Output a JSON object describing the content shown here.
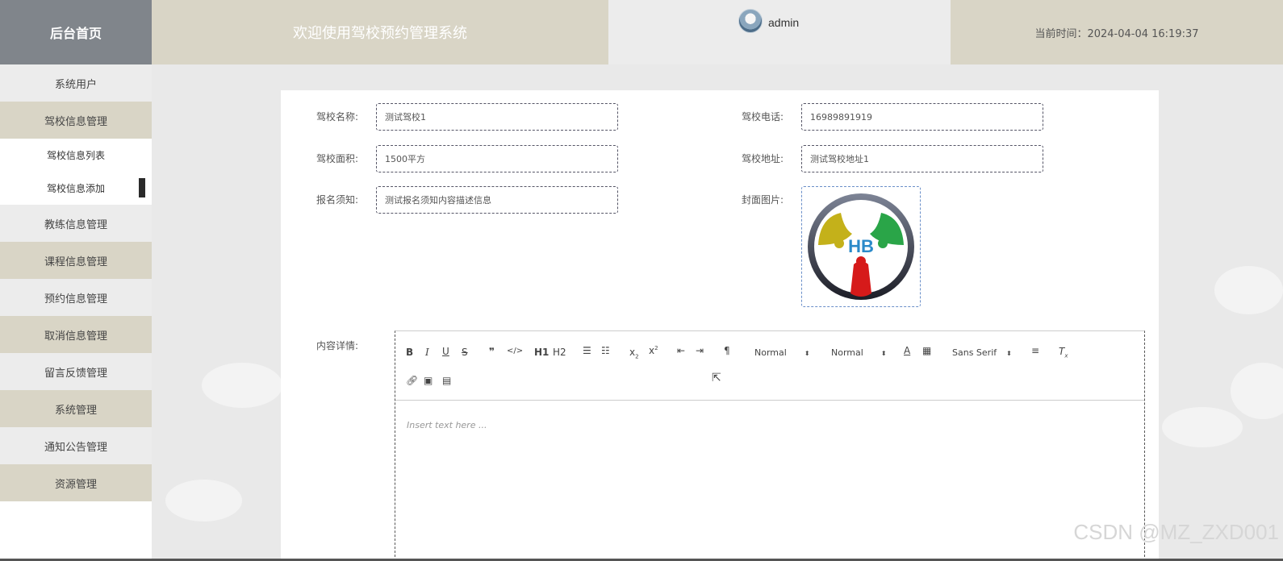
{
  "header": {
    "logo_title": "后台首页",
    "welcome": "欢迎使用驾校预约管理系统",
    "username": "admin",
    "current_time": "当前时间：2024-04-04 16:19:37"
  },
  "sidebar": {
    "items": [
      {
        "label": "系统用户"
      },
      {
        "label": "驾校信息管理"
      },
      {
        "label": "驾校信息列表"
      },
      {
        "label": "驾校信息添加"
      },
      {
        "label": "教练信息管理"
      },
      {
        "label": "课程信息管理"
      },
      {
        "label": "预约信息管理"
      },
      {
        "label": "取消信息管理"
      },
      {
        "label": "留言反馈管理"
      },
      {
        "label": "系统管理"
      },
      {
        "label": "通知公告管理"
      },
      {
        "label": "资源管理"
      }
    ]
  },
  "form": {
    "name_label": "驾校名称:",
    "name_value": "测试驾校1",
    "phone_label": "驾校电话:",
    "phone_value": "16989891919",
    "area_label": "驾校面积:",
    "area_value": "1500平方",
    "address_label": "驾校地址:",
    "address_value": "测试驾校地址1",
    "notice_label": "报名须知:",
    "notice_value": "测试报名须知内容描述信息",
    "cover_label": "封面图片:",
    "content_label": "内容详情:"
  },
  "editor": {
    "toolbar": {
      "h1": "H1",
      "h2": "H2",
      "size_select": "Normal",
      "header_select": "Normal",
      "font_select": "Sans Serif"
    },
    "placeholder": "Insert text here ..."
  },
  "logo_text": "HB",
  "watermark": "CSDN @MZ_ZXD001",
  "colors": {
    "header_tan": "#d9d5c6",
    "logo_gray": "#80858b",
    "page_bg": "#e9e9e9"
  }
}
